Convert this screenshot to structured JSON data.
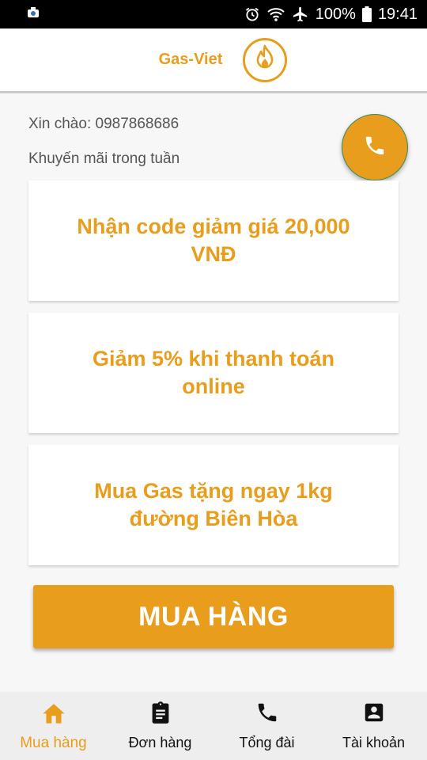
{
  "status_bar": {
    "battery": "100%",
    "time": "19:41"
  },
  "header": {
    "title": "Gas-Viet",
    "logo_icon": "flame-icon"
  },
  "main": {
    "greeting": "Xin chào: 0987868686",
    "promo_heading": "Khuyến mãi trong tuần",
    "promos": [
      "Nhận code giảm giá 20,000 VNĐ",
      "Giảm 5% khi thanh toán online",
      "Mua Gas tặng ngay 1kg đường Biên Hòa"
    ],
    "buy_label": "MUA HÀNG",
    "call_icon": "phone-icon"
  },
  "bottom_nav": {
    "items": [
      {
        "label": "Mua hàng",
        "icon": "home-icon",
        "active": true
      },
      {
        "label": "Đơn hàng",
        "icon": "clipboard-icon",
        "active": false
      },
      {
        "label": "Tổng đài",
        "icon": "phone-icon",
        "active": false
      },
      {
        "label": "Tài khoản",
        "icon": "account-box-icon",
        "active": false
      }
    ]
  },
  "colors": {
    "accent": "#e89d1c",
    "status_bar": "#000000",
    "nav_background": "#eeeeee"
  }
}
